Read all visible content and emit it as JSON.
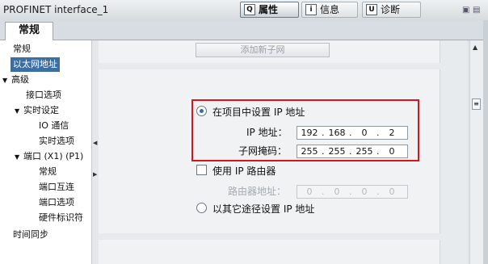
{
  "window": {
    "title": "PROFINET interface_1",
    "tabs": [
      {
        "label": "属性",
        "icon": "Q",
        "active": true
      },
      {
        "label": "信息",
        "icon": "i",
        "active": false
      },
      {
        "label": "诊断",
        "icon": "U",
        "active": false
      }
    ],
    "controls": [
      "restore-icon",
      "menu-icon"
    ]
  },
  "section_tab": {
    "label": "常规"
  },
  "nav": {
    "items": [
      {
        "label": "常规"
      },
      {
        "label": "以太网地址",
        "selected": true
      },
      {
        "label": "高级",
        "expanded": true
      },
      {
        "label": "接口选项"
      },
      {
        "label": "实时设定",
        "expanded": true
      },
      {
        "label": "IO 通信"
      },
      {
        "label": "实时选项"
      },
      {
        "label": "端口 (X1) (P1)",
        "expanded": true
      },
      {
        "label": "常规"
      },
      {
        "label": "端口互连"
      },
      {
        "label": "端口选项"
      },
      {
        "label": "硬件标识符"
      },
      {
        "label": "时间同步"
      }
    ]
  },
  "form": {
    "add_subnet_button": "添加新子网",
    "set_ip_in_project": "在项目中设置 IP 地址",
    "ip_address_label": "IP 地址：",
    "ip_address": [
      "192",
      "168",
      "0",
      "2"
    ],
    "subnet_mask_label": "子网掩码：",
    "subnet_mask": [
      "255",
      "255",
      "255",
      "0"
    ],
    "use_router_label": "使用 IP 路由器",
    "router_address_label": "路由器地址：",
    "router_address": [
      "0",
      "0",
      "0",
      "0"
    ],
    "other_method_label": "以其它途径设置 IP 地址"
  }
}
